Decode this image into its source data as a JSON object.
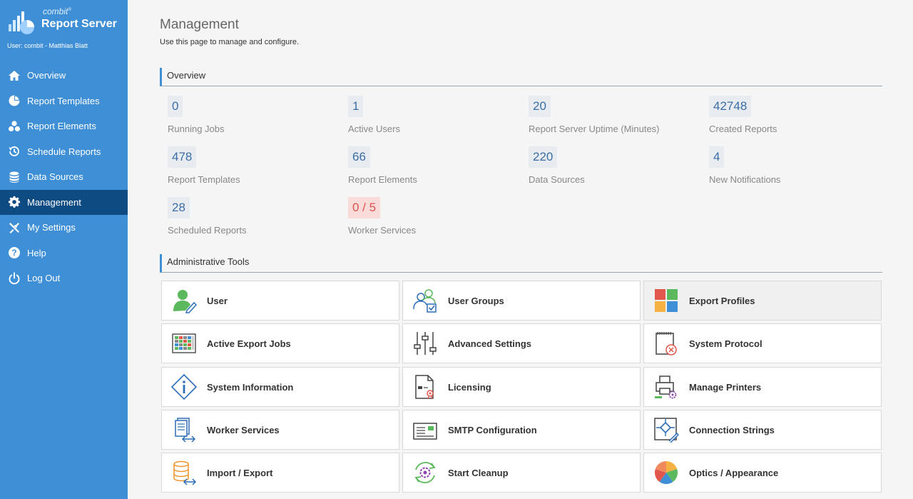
{
  "brand": {
    "small": "combit",
    "title": "Report Server"
  },
  "user_line": "User: combit - Matthias Blatt",
  "nav": [
    {
      "label": "Overview",
      "icon": "home-icon"
    },
    {
      "label": "Report Templates",
      "icon": "pie-chart-icon"
    },
    {
      "label": "Report Elements",
      "icon": "elements-icon"
    },
    {
      "label": "Schedule Reports",
      "icon": "history-icon"
    },
    {
      "label": "Data Sources",
      "icon": "database-icon"
    },
    {
      "label": "Management",
      "icon": "gear-icon",
      "active": true
    },
    {
      "label": "My Settings",
      "icon": "tools-icon"
    },
    {
      "label": "Help",
      "icon": "help-icon"
    },
    {
      "label": "Log Out",
      "icon": "power-icon"
    }
  ],
  "page": {
    "title": "Management",
    "subtitle": "Use this page to manage and configure."
  },
  "overview": {
    "heading": "Overview",
    "stats": [
      {
        "value": "0",
        "label": "Running Jobs"
      },
      {
        "value": "1",
        "label": "Active Users"
      },
      {
        "value": "20",
        "label": "Report Server Uptime (Minutes)"
      },
      {
        "value": "42748",
        "label": "Created Reports"
      },
      {
        "value": "478",
        "label": "Report Templates"
      },
      {
        "value": "66",
        "label": "Report Elements"
      },
      {
        "value": "220",
        "label": "Data Sources"
      },
      {
        "value": "4",
        "label": "New Notifications"
      },
      {
        "value": "28",
        "label": "Scheduled Reports"
      },
      {
        "value": "0 / 5",
        "label": "Worker Services",
        "alert": true
      }
    ]
  },
  "admin": {
    "heading": "Administrative Tools",
    "tools": [
      {
        "label": "User",
        "icon": "user-edit-icon"
      },
      {
        "label": "User Groups",
        "icon": "user-group-icon"
      },
      {
        "label": "Export Profiles",
        "icon": "export-profiles-icon"
      },
      {
        "label": "Active Export Jobs",
        "icon": "export-jobs-icon"
      },
      {
        "label": "Advanced Settings",
        "icon": "sliders-icon"
      },
      {
        "label": "System Protocol",
        "icon": "protocol-icon"
      },
      {
        "label": "System Information",
        "icon": "info-icon"
      },
      {
        "label": "Licensing",
        "icon": "license-icon"
      },
      {
        "label": "Manage Printers",
        "icon": "printer-icon"
      },
      {
        "label": "Worker Services",
        "icon": "worker-services-icon"
      },
      {
        "label": "SMTP Configuration",
        "icon": "smtp-icon"
      },
      {
        "label": "Connection Strings",
        "icon": "connection-icon"
      },
      {
        "label": "Import / Export",
        "icon": "import-export-icon"
      },
      {
        "label": "Start Cleanup",
        "icon": "cleanup-icon"
      },
      {
        "label": "Optics / Appearance",
        "icon": "appearance-icon"
      }
    ]
  },
  "colors": {
    "sidebar": "#3f8fd6",
    "active_nav": "#0f4b83",
    "stat_value": "#3a6ea5",
    "alert": "#d9534f"
  }
}
